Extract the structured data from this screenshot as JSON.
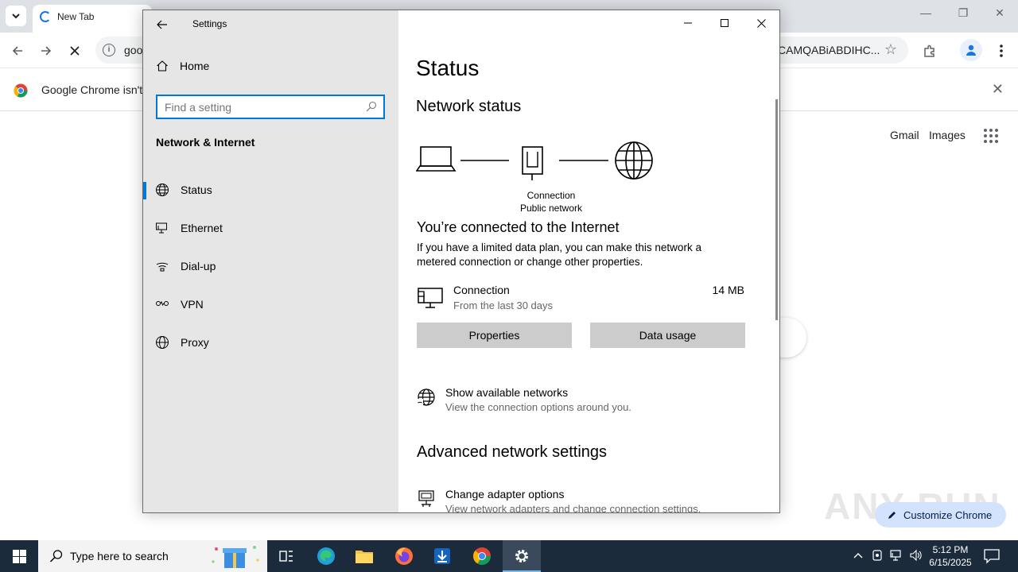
{
  "chrome": {
    "tab_title": "New Tab",
    "url_start": "goo",
    "url_end": "CAMQABiABDIHC...",
    "infobar_text": "Google Chrome isn't y",
    "links": {
      "gmail": "Gmail",
      "images": "Images"
    },
    "customize_label": "Customize Chrome",
    "watermark": "ANY RUN"
  },
  "settings": {
    "window_title": "Settings",
    "nav": {
      "home_label": "Home",
      "search_placeholder": "Find a setting",
      "section_heading": "Network & Internet",
      "items": [
        {
          "label": "Status",
          "icon": "globe-icon",
          "selected": true
        },
        {
          "label": "Ethernet",
          "icon": "ethernet-icon",
          "selected": false
        },
        {
          "label": "Dial-up",
          "icon": "dialup-icon",
          "selected": false
        },
        {
          "label": "VPN",
          "icon": "vpn-icon",
          "selected": false
        },
        {
          "label": "Proxy",
          "icon": "globe-icon",
          "selected": false
        }
      ]
    },
    "main": {
      "page_title": "Status",
      "network_status_heading": "Network status",
      "diagram": {
        "connection_name": "Connection",
        "network_type": "Public network"
      },
      "connected_title": "You’re connected to the Internet",
      "description": "If you have a limited data plan, you can make this network a metered connection or change other properties.",
      "connection": {
        "name": "Connection",
        "period": "From the last 30 days",
        "usage": "14 MB"
      },
      "buttons": {
        "properties": "Properties",
        "data_usage": "Data usage"
      },
      "show_networks": {
        "title": "Show available networks",
        "subtitle": "View the connection options around you."
      },
      "advanced_heading": "Advanced network settings",
      "change_adapter": {
        "title": "Change adapter options",
        "subtitle": "View network adapters and change connection settings."
      }
    }
  },
  "taskbar": {
    "search_placeholder": "Type here to search",
    "time": "5:12 PM",
    "date": "6/15/2025"
  },
  "colors": {
    "accent": "#0078d7",
    "nav_bg": "#e6e6e6",
    "taskbar": "#1c2b3c"
  }
}
